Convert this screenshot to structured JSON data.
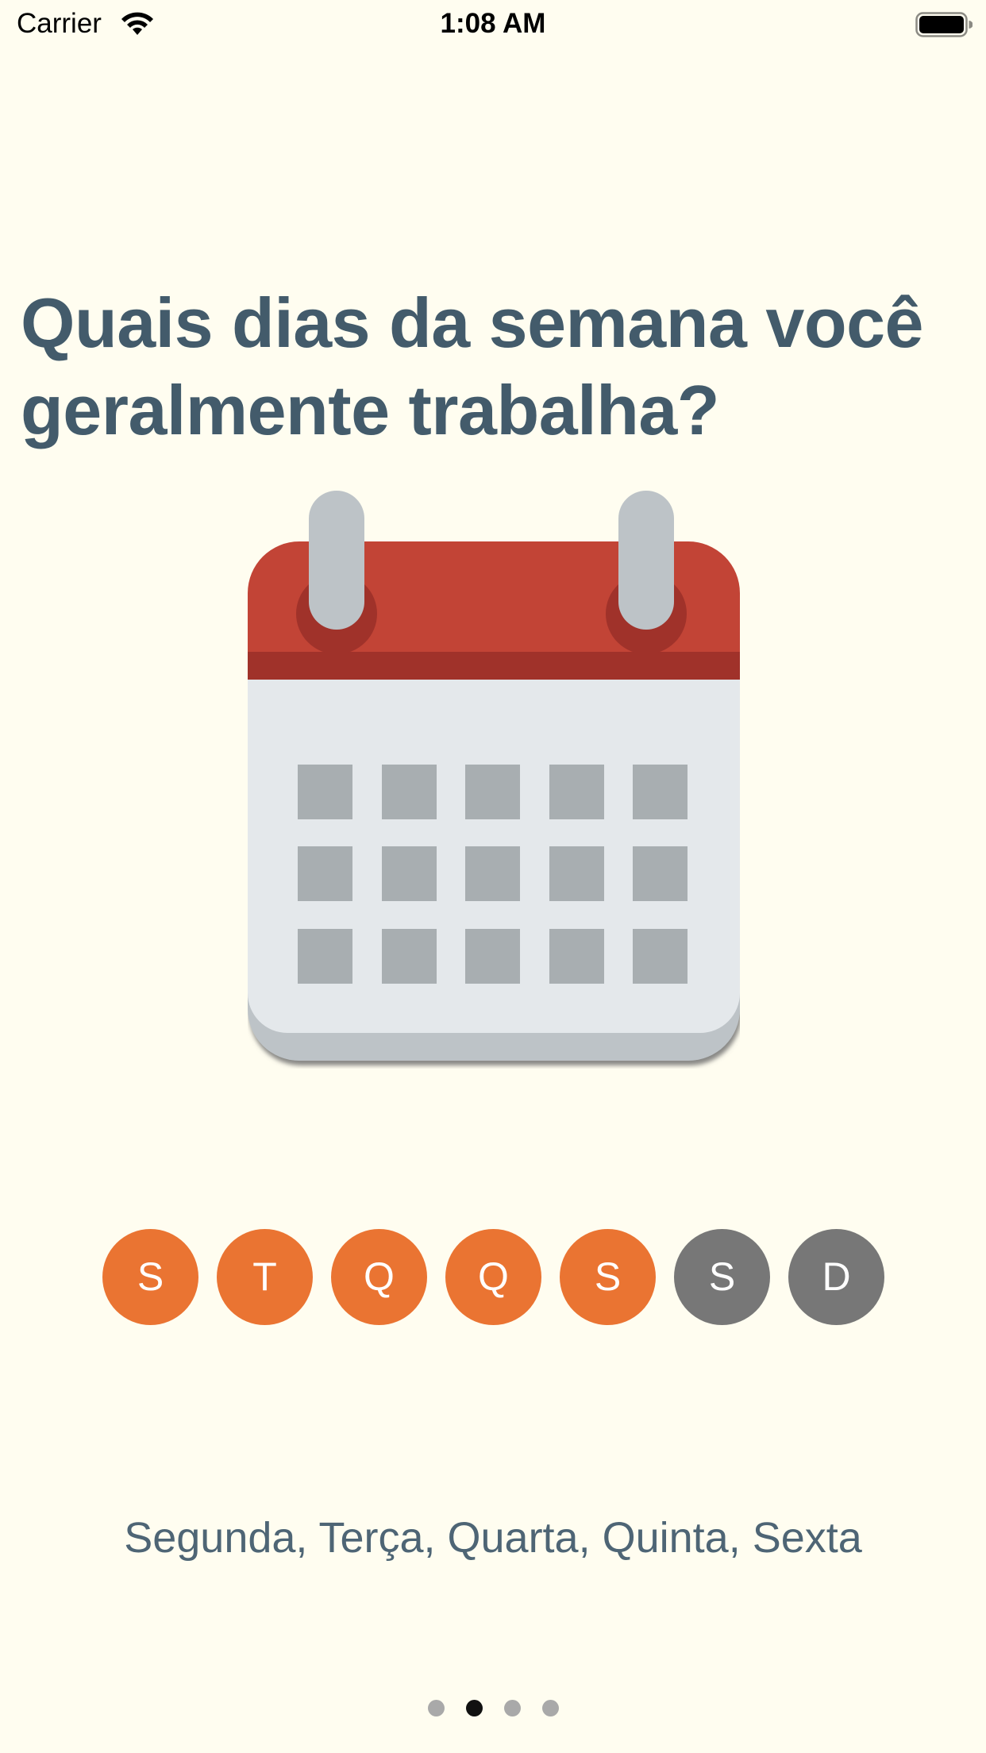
{
  "status_bar": {
    "carrier": "Carrier",
    "time": "1:08 AM",
    "icons": [
      "wifi-icon",
      "battery-icon"
    ]
  },
  "question": "Quais dias da semana você geralmente trabalha?",
  "illustration": {
    "icon": "calendar-icon",
    "colors": {
      "header": "#C24436",
      "header_band": "#A0322A",
      "rings": "#BDC3C7",
      "body": "#E4E8EB",
      "cells": "#A8AEB1"
    }
  },
  "days": [
    {
      "label": "S",
      "selected": true
    },
    {
      "label": "T",
      "selected": true
    },
    {
      "label": "Q",
      "selected": true
    },
    {
      "label": "Q",
      "selected": true
    },
    {
      "label": "S",
      "selected": true
    },
    {
      "label": "S",
      "selected": false
    },
    {
      "label": "D",
      "selected": false
    }
  ],
  "summary": "Segunda, Terça, Quarta, Quinta, Sexta",
  "pager": {
    "pages": 4,
    "current": 2
  },
  "colors": {
    "background": "#FFFDF0",
    "heading": "#435B6B",
    "selected_day": "#EA7432",
    "unselected_day": "#777777",
    "summary": "#4E6575"
  }
}
